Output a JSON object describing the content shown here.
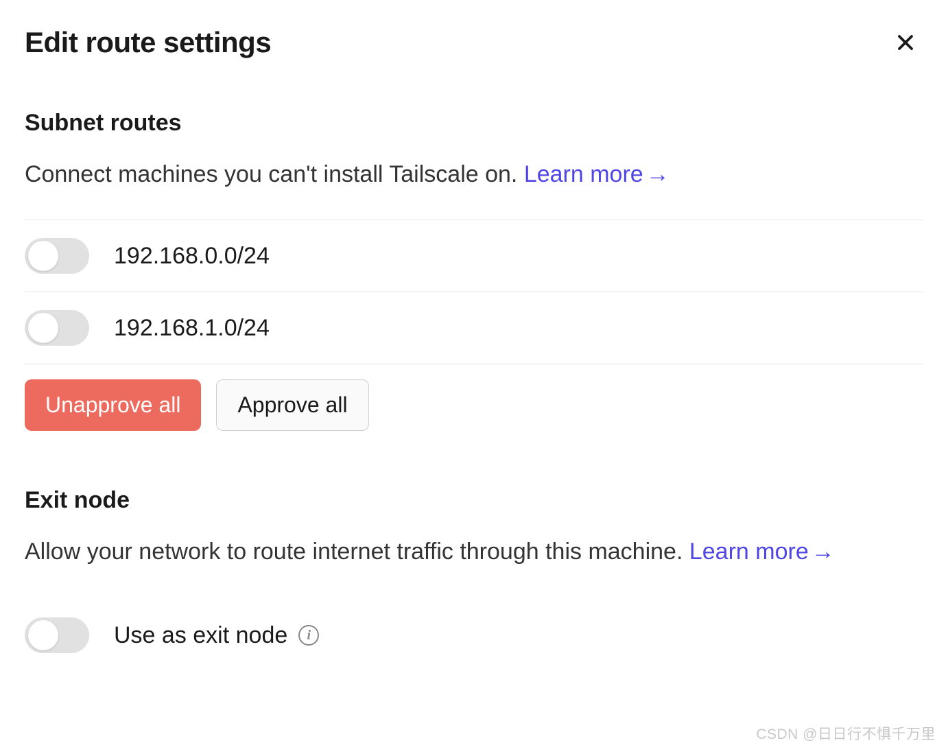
{
  "dialog": {
    "title": "Edit route settings"
  },
  "subnet": {
    "heading": "Subnet routes",
    "description": "Connect machines you can't install Tailscale on. ",
    "learn_more": "Learn more",
    "routes": [
      {
        "cidr": "192.168.0.0/24",
        "enabled": false
      },
      {
        "cidr": "192.168.1.0/24",
        "enabled": false
      }
    ],
    "unapprove_label": "Unapprove all",
    "approve_label": "Approve all"
  },
  "exit_node": {
    "heading": "Exit node",
    "description": "Allow your network to route internet traffic through this machine. ",
    "learn_more": "Learn more",
    "toggle_label": "Use as exit node",
    "enabled": false
  },
  "watermark": "CSDN @日日行不惧千万里"
}
